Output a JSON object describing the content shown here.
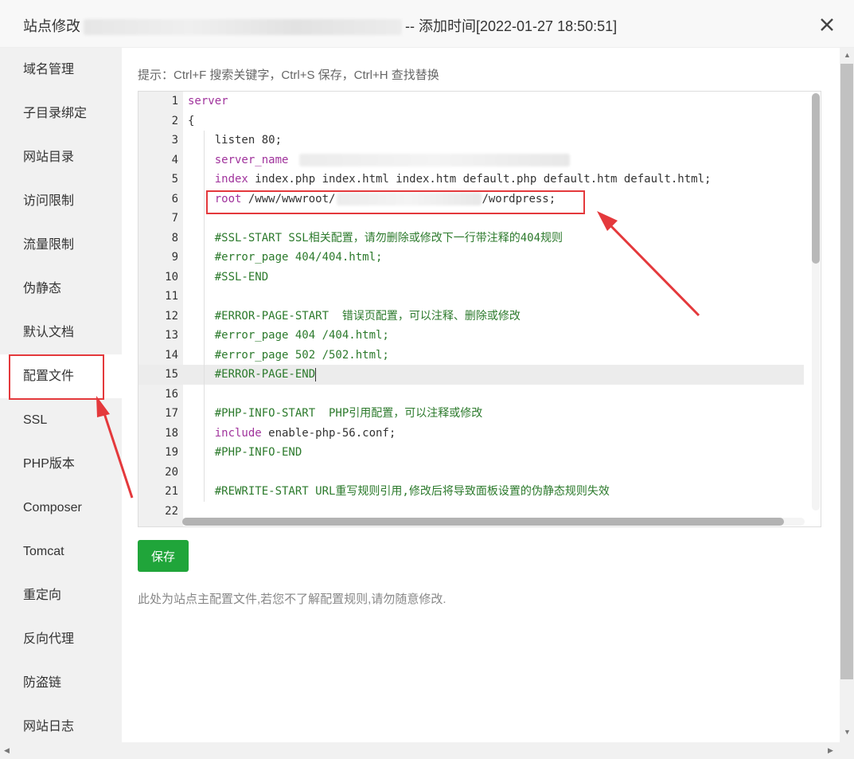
{
  "window": {
    "title_prefix": "站点修改",
    "title_suffix": "-- 添加时间[2022-01-27 18:50:51]",
    "close_icon": "close-icon"
  },
  "sidebar": {
    "items": [
      {
        "label": "域名管理"
      },
      {
        "label": "子目录绑定"
      },
      {
        "label": "网站目录"
      },
      {
        "label": "访问限制"
      },
      {
        "label": "流量限制"
      },
      {
        "label": "伪静态"
      },
      {
        "label": "默认文档"
      },
      {
        "label": "配置文件",
        "active": true
      },
      {
        "label": "SSL"
      },
      {
        "label": "PHP版本"
      },
      {
        "label": "Composer"
      },
      {
        "label": "Tomcat"
      },
      {
        "label": "重定向"
      },
      {
        "label": "反向代理"
      },
      {
        "label": "防盗链"
      },
      {
        "label": "网站日志"
      }
    ]
  },
  "main": {
    "tip": "提示：Ctrl+F 搜索关键字，Ctrl+S 保存，Ctrl+H 查找替换",
    "save_label": "保存",
    "note": "此处为站点主配置文件,若您不了解配置规则,请勿随意修改."
  },
  "editor": {
    "active_line": 15,
    "lines": [
      {
        "n": "1",
        "kw": "server",
        "rest": ""
      },
      {
        "n": "2",
        "kw": "",
        "rest": "{"
      },
      {
        "n": "3",
        "kw": "",
        "rest": "    listen 80;"
      },
      {
        "n": "4",
        "kw": "    server_name",
        "rest": ""
      },
      {
        "n": "5",
        "kw": "    index",
        "rest": " index.php index.html index.htm default.php default.htm default.html;"
      },
      {
        "n": "6",
        "kw": "    root",
        "rest": " /www/wwwroot/",
        "tail": "/wordpress;"
      },
      {
        "n": "7",
        "kw": "",
        "rest": ""
      },
      {
        "n": "8",
        "cm": "    #SSL-START SSL相关配置，请勿删除或修改下一行带注释的404规则"
      },
      {
        "n": "9",
        "cm": "    #error_page 404/404.html;"
      },
      {
        "n": "10",
        "cm": "    #SSL-END"
      },
      {
        "n": "11",
        "kw": "",
        "rest": ""
      },
      {
        "n": "12",
        "cm": "    #ERROR-PAGE-START  错误页配置，可以注释、删除或修改"
      },
      {
        "n": "13",
        "cm": "    #error_page 404 /404.html;"
      },
      {
        "n": "14",
        "cm": "    #error_page 502 /502.html;"
      },
      {
        "n": "15",
        "cm": "    #ERROR-PAGE-END"
      },
      {
        "n": "16",
        "kw": "",
        "rest": ""
      },
      {
        "n": "17",
        "cm": "    #PHP-INFO-START  PHP引用配置，可以注释或修改"
      },
      {
        "n": "18",
        "kw": "    include",
        "rest": " enable-php-56.conf;"
      },
      {
        "n": "19",
        "cm": "    #PHP-INFO-END"
      },
      {
        "n": "20",
        "kw": "",
        "rest": ""
      },
      {
        "n": "21",
        "cm": "    #REWRITE-START URL重写规则引用,修改后将导致面板设置的伪静态规则失效"
      },
      {
        "n": "22",
        "kw": "",
        "rest": ""
      }
    ]
  },
  "colors": {
    "accent_green": "#20a53a",
    "annotation_red": "#e4393c",
    "keyword": "#a0339c",
    "comment": "#2c7a2c"
  }
}
